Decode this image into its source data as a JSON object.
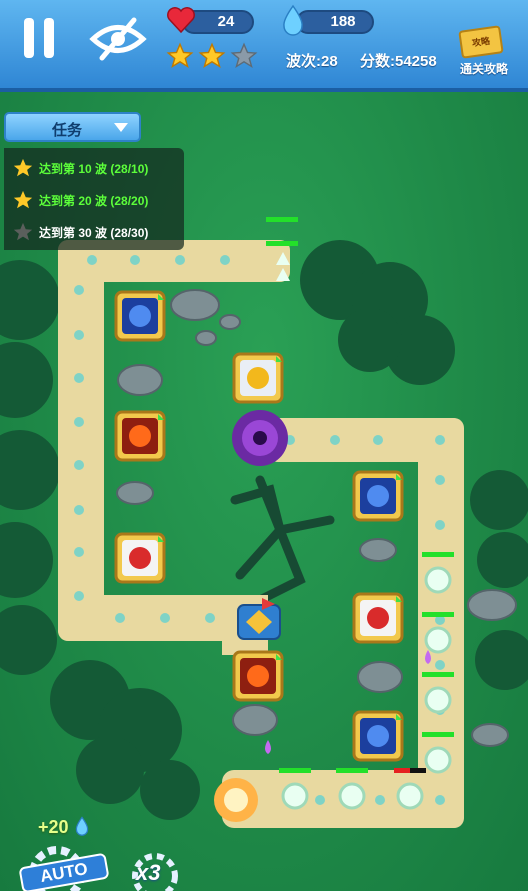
{
  "hud": {
    "lives": "24",
    "water": "188",
    "stars_earned": 2,
    "stars_total": 3,
    "wave_text": "波次:28",
    "score_text": "分数:54258",
    "guide_label": "通关攻略",
    "guide_badge": "攻略"
  },
  "tasks": {
    "tab_label": "任务",
    "items": [
      {
        "label": "达到第 10 波 (28/10)",
        "done": true
      },
      {
        "label": "达到第 20 波 (28/20)",
        "done": true
      },
      {
        "label": "达到第 30 波 (28/30)",
        "done": false
      }
    ]
  },
  "bottom": {
    "income_text": "+20",
    "auto_label": "AUTO",
    "speed_label": "x3"
  },
  "colors": {
    "task_done": "#5cff3a",
    "task_pending": "#ffffff",
    "path": "#e8d9a0",
    "hp_bar": "#23e02a",
    "hp_bar_low": "#e52020"
  },
  "towers": [
    {
      "type": "blue-vortex"
    },
    {
      "type": "white-gold-arrow"
    },
    {
      "type": "red-fire"
    },
    {
      "type": "blue-vortex"
    },
    {
      "type": "red-white-rocket"
    },
    {
      "type": "red-white-rocket"
    },
    {
      "type": "red-fire"
    },
    {
      "type": "blue-vortex"
    }
  ]
}
